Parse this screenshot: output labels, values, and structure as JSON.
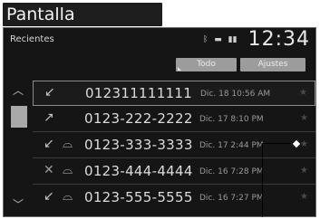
{
  "page_title": "Pantalla Recientes",
  "screen": {
    "title": "Recientes",
    "status_icons": [
      "bluetooth-icon",
      "battery-icon",
      "signal-icon"
    ],
    "clock": "12:34"
  },
  "tabs": [
    {
      "label": "Todo"
    },
    {
      "label": "Ajustes"
    }
  ],
  "calls": [
    {
      "number": "012311111111",
      "datetime": "Dic. 18 10:56 AM",
      "call_icon": "incoming-call-icon",
      "voicemail": false
    },
    {
      "number": "0123-222-2222",
      "datetime": "Dic. 17 8:10 PM",
      "call_icon": "outgoing-call-icon",
      "voicemail": false
    },
    {
      "number": "0123-333-3333",
      "datetime": "Dic. 17 2:44 PM",
      "call_icon": "incoming-call-icon",
      "voicemail": true
    },
    {
      "number": "0123-444-4444",
      "datetime": "Dic. 16 7:28 PM",
      "call_icon": "missed-call-icon",
      "voicemail": true
    },
    {
      "number": "0123-555-5555",
      "datetime": "Dic. 16 7:27 PM",
      "call_icon": "incoming-call-icon",
      "voicemail": true
    }
  ]
}
